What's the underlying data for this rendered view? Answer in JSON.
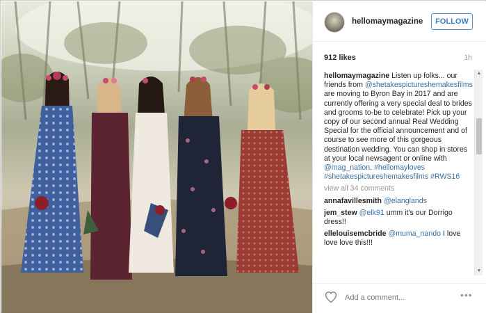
{
  "post": {
    "username": "hellomaymagazine",
    "follow_label": "FOLLOW",
    "likes": "912 likes",
    "time": "1h"
  },
  "caption": {
    "author": "hellomaymagazine",
    "text_1": "Listen up folks... our friends from",
    "mention_1": "@shetakespictureshemakesfilms",
    "text_2": "are moving to Byron Bay in 2017 and are currently offering a very special deal to brides and grooms to-be to celebrate! Pick up your copy of our second annual Real Wedding Special for the official announcement and of course to see more of this gorgeous destination wedding. You can shop in stores at your local newsagent or online with",
    "mention_2": "@mag_nation",
    "text_3": ".",
    "hashtag_1": "#hellomayloves",
    "hashtag_2": "#shetakespictureshemakesfilms",
    "hashtag_3": "#RWS16"
  },
  "view_all": "view all 34 comments",
  "comments": [
    {
      "user": "annafavillesmith",
      "mention": "@elanglands",
      "text": ""
    },
    {
      "user": "jem_stew",
      "mention": "@elk91",
      "text": "umm it's our Dorrigo dress!!"
    },
    {
      "user": "ellelouisemcbride",
      "mention": "@muma_nando",
      "text": "I love love love this!!!"
    }
  ],
  "footer": {
    "placeholder": "Add a comment...",
    "more": "•••"
  },
  "icons": {
    "heart": "heart-icon",
    "more": "more-options-icon",
    "avatar": "avatar"
  }
}
